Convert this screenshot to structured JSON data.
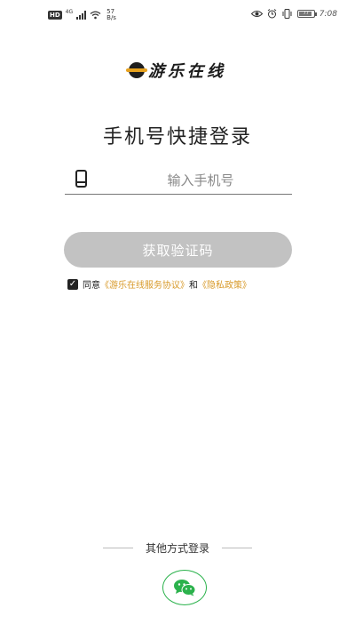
{
  "status_bar": {
    "hd": "HD",
    "network": "4G",
    "speed_value": "57",
    "speed_unit": "B/s",
    "battery": "77",
    "time": "7:08"
  },
  "app": {
    "name": "游乐在线"
  },
  "login": {
    "title": "手机号快捷登录",
    "phone_placeholder": "输入手机号",
    "get_code_label": "获取验证码",
    "agree_prefix": "同意",
    "service_agreement": "《游乐在线服务协议》",
    "agree_and": "和",
    "privacy_policy": "《隐私政策》",
    "other_methods": "其他方式登录"
  },
  "colors": {
    "link": "#d89a2a",
    "button_disabled": "#c2c2c2",
    "wechat_green": "#2bb24c"
  }
}
